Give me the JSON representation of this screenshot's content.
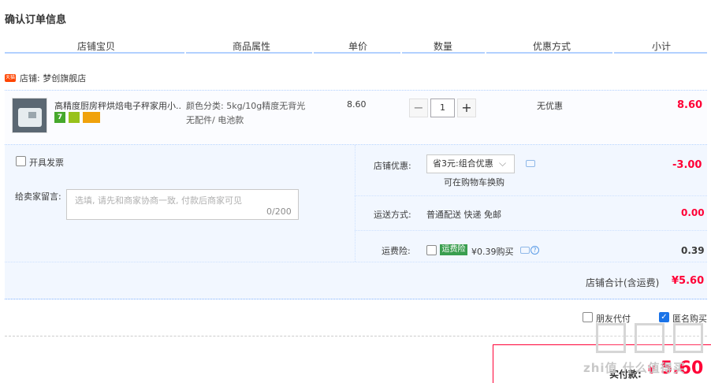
{
  "page_title": "确认订单信息",
  "columns": [
    "店铺宝贝",
    "商品属性",
    "单价",
    "数量",
    "优惠方式",
    "小计"
  ],
  "shop": {
    "badge_icon": "tmall-shop-icon",
    "label": "店铺: 梦创旗舰店"
  },
  "item": {
    "title": "高精度厨房秤烘焙电子秤家用小...",
    "props_line1": "颜色分类: 5kg/10g精度无背光",
    "props_line2": "无配件/ 电池款",
    "price": "8.60",
    "quantity": "1",
    "qty_minus": "−",
    "qty_plus": "+",
    "promo": "无优惠",
    "subtotal": "8.60",
    "service_badge_text": "7"
  },
  "invoice": {
    "label": "开具发票"
  },
  "message": {
    "label": "给卖家留言:",
    "placeholder": "选填, 请先和商家协商一致, 付款后商家可见",
    "counter": "0/200"
  },
  "shop_discount": {
    "label": "店铺优惠:",
    "selected": "省3元:组合优惠",
    "note": "可在购物车换购",
    "value": "-3.00"
  },
  "delivery": {
    "label": "运送方式:",
    "method": "普通配送 快递 免邮",
    "value": "0.00"
  },
  "freight_insurance": {
    "label": "运费险:",
    "badge": "运费险",
    "price_text": "¥0.39购买",
    "value": "0.39"
  },
  "shop_total": {
    "label": "店铺合计(含运费)",
    "value": "¥5.60"
  },
  "options": {
    "friend_pay": "朋友代付",
    "anonymous": "匿名购买",
    "anonymous_checked": true
  },
  "payment": {
    "label": "实付款:",
    "currency": "¥",
    "amount": "5.60"
  },
  "watermark": {
    "site": "zhi值 什么值得买"
  },
  "colors": {
    "accent_red": "#ff0036",
    "header_line": "#b2d1ff",
    "option_bg": "#f2f7ff"
  }
}
